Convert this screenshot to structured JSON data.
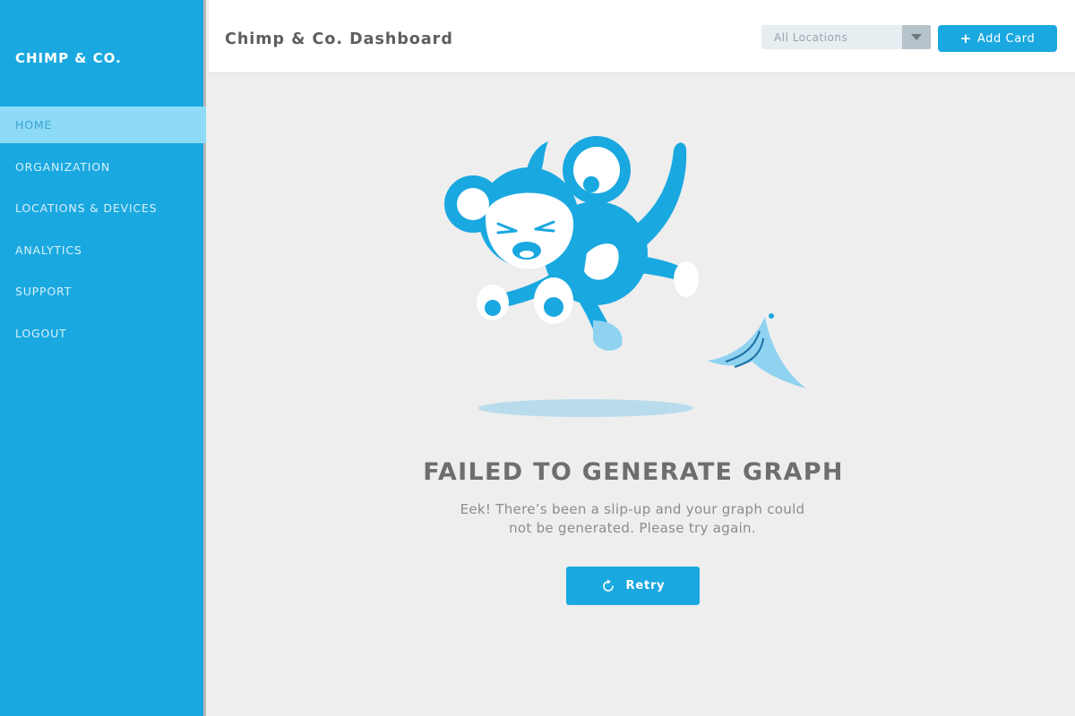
{
  "sidebar": {
    "brand": "CHIMP & CO.",
    "items": [
      {
        "label": "HOME",
        "active": true
      },
      {
        "label": "ORGANIZATION",
        "active": false
      },
      {
        "label": "LOCATIONS & DEVICES",
        "active": false
      },
      {
        "label": "ANALYTICS",
        "active": false
      },
      {
        "label": "SUPPORT",
        "active": false
      },
      {
        "label": "LOGOUT",
        "active": false
      }
    ]
  },
  "header": {
    "title": "Chimp & Co. Dashboard",
    "location_select": {
      "value": "All Locations",
      "icon": "triangle-down-icon"
    },
    "add_card": {
      "label": "Add Card",
      "icon": "plus-icon"
    }
  },
  "error": {
    "title": "FAILED TO GENERATE GRAPH",
    "message_line1": "Eek! There’s been a slip-up and your graph could",
    "message_line2": "not be generated. Please try again.",
    "retry_label": "Retry",
    "retry_icon": "refresh-icon",
    "illustration": "falling-monkey-with-banana-peel"
  },
  "colors": {
    "brand_blue": "#1aa8e0",
    "active_nav": "#8ddbf7",
    "background": "#eeeeee",
    "illustration_light": "#8fd3f1",
    "shadow": "#b9dcec"
  }
}
